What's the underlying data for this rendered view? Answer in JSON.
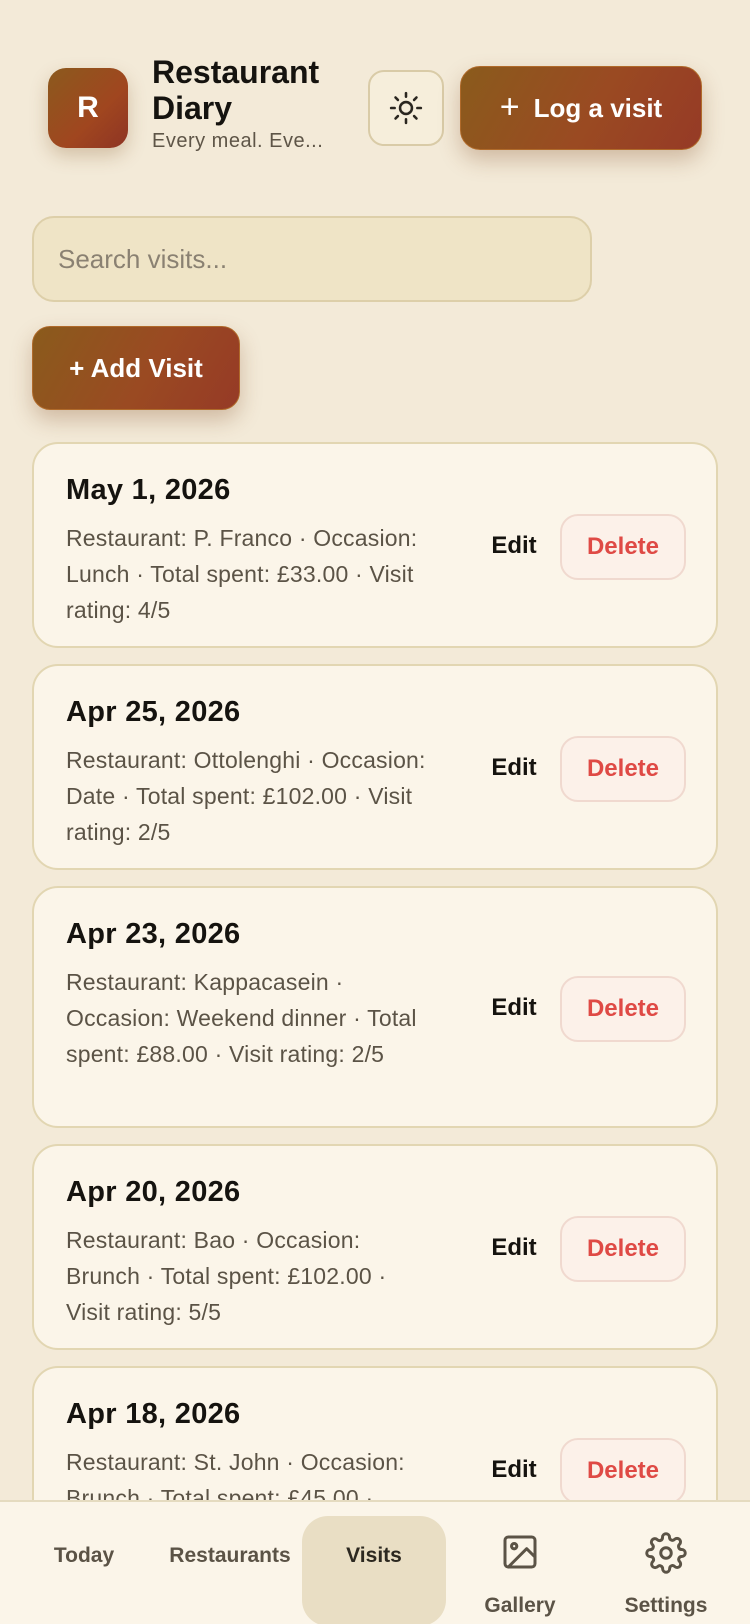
{
  "header": {
    "avatar_letter": "R",
    "title": "Restaurant Diary",
    "subtitle": "Every meal. Eve...",
    "theme_icon": "sun-icon",
    "log_visit_label": "Log a visit"
  },
  "search": {
    "placeholder": "Search visits..."
  },
  "add_visit_label": "+ Add Visit",
  "visits": [
    {
      "date": "May 1, 2026",
      "details": "Restaurant: P. Franco · Occasion: Lunch · Total spent: £33.00 · Visit rating: 4/5",
      "edit": "Edit",
      "delete": "Delete"
    },
    {
      "date": "Apr 25, 2026",
      "details": "Restaurant: Ottolenghi · Occasion: Date · Total spent: £102.00 · Visit rating: 2/5",
      "edit": "Edit",
      "delete": "Delete"
    },
    {
      "date": "Apr 23, 2026",
      "details": "Restaurant: Kappacasein · Occasion: Weekend dinner · Total spent: £88.00 · Visit rating: 2/5",
      "edit": "Edit",
      "delete": "Delete"
    },
    {
      "date": "Apr 20, 2026",
      "details": "Restaurant: Bao · Occasion: Brunch · Total spent: £102.00 · Visit rating: 5/5",
      "edit": "Edit",
      "delete": "Delete"
    },
    {
      "date": "Apr 18, 2026",
      "details": "Restaurant: St. John · Occasion: Brunch · Total spent: £45.00 ·",
      "edit": "Edit",
      "delete": "Delete"
    }
  ],
  "nav": [
    {
      "label": "Today"
    },
    {
      "label": "Restaurants"
    },
    {
      "label": "Visits",
      "active": true
    },
    {
      "label": "Gallery",
      "icon": "image-icon"
    },
    {
      "label": "Settings",
      "icon": "gear-icon"
    }
  ],
  "colors": {
    "background": "#f3ead8",
    "card": "#fbf5e9",
    "accent_start": "#8a5b1c",
    "accent_end": "#963a26",
    "delete": "#df4a45"
  }
}
